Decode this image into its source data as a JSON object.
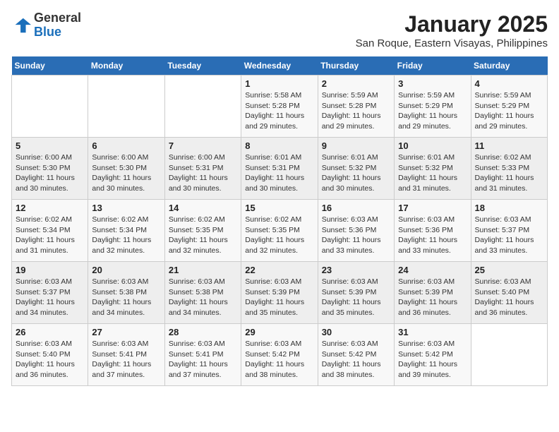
{
  "header": {
    "logo_general": "General",
    "logo_blue": "Blue",
    "title": "January 2025",
    "subtitle": "San Roque, Eastern Visayas, Philippines"
  },
  "weekdays": [
    "Sunday",
    "Monday",
    "Tuesday",
    "Wednesday",
    "Thursday",
    "Friday",
    "Saturday"
  ],
  "weeks": [
    [
      {
        "day": "",
        "detail": ""
      },
      {
        "day": "",
        "detail": ""
      },
      {
        "day": "",
        "detail": ""
      },
      {
        "day": "1",
        "detail": "Sunrise: 5:58 AM\nSunset: 5:28 PM\nDaylight: 11 hours\nand 29 minutes."
      },
      {
        "day": "2",
        "detail": "Sunrise: 5:59 AM\nSunset: 5:28 PM\nDaylight: 11 hours\nand 29 minutes."
      },
      {
        "day": "3",
        "detail": "Sunrise: 5:59 AM\nSunset: 5:29 PM\nDaylight: 11 hours\nand 29 minutes."
      },
      {
        "day": "4",
        "detail": "Sunrise: 5:59 AM\nSunset: 5:29 PM\nDaylight: 11 hours\nand 29 minutes."
      }
    ],
    [
      {
        "day": "5",
        "detail": "Sunrise: 6:00 AM\nSunset: 5:30 PM\nDaylight: 11 hours\nand 30 minutes."
      },
      {
        "day": "6",
        "detail": "Sunrise: 6:00 AM\nSunset: 5:30 PM\nDaylight: 11 hours\nand 30 minutes."
      },
      {
        "day": "7",
        "detail": "Sunrise: 6:00 AM\nSunset: 5:31 PM\nDaylight: 11 hours\nand 30 minutes."
      },
      {
        "day": "8",
        "detail": "Sunrise: 6:01 AM\nSunset: 5:31 PM\nDaylight: 11 hours\nand 30 minutes."
      },
      {
        "day": "9",
        "detail": "Sunrise: 6:01 AM\nSunset: 5:32 PM\nDaylight: 11 hours\nand 30 minutes."
      },
      {
        "day": "10",
        "detail": "Sunrise: 6:01 AM\nSunset: 5:32 PM\nDaylight: 11 hours\nand 31 minutes."
      },
      {
        "day": "11",
        "detail": "Sunrise: 6:02 AM\nSunset: 5:33 PM\nDaylight: 11 hours\nand 31 minutes."
      }
    ],
    [
      {
        "day": "12",
        "detail": "Sunrise: 6:02 AM\nSunset: 5:34 PM\nDaylight: 11 hours\nand 31 minutes."
      },
      {
        "day": "13",
        "detail": "Sunrise: 6:02 AM\nSunset: 5:34 PM\nDaylight: 11 hours\nand 32 minutes."
      },
      {
        "day": "14",
        "detail": "Sunrise: 6:02 AM\nSunset: 5:35 PM\nDaylight: 11 hours\nand 32 minutes."
      },
      {
        "day": "15",
        "detail": "Sunrise: 6:02 AM\nSunset: 5:35 PM\nDaylight: 11 hours\nand 32 minutes."
      },
      {
        "day": "16",
        "detail": "Sunrise: 6:03 AM\nSunset: 5:36 PM\nDaylight: 11 hours\nand 33 minutes."
      },
      {
        "day": "17",
        "detail": "Sunrise: 6:03 AM\nSunset: 5:36 PM\nDaylight: 11 hours\nand 33 minutes."
      },
      {
        "day": "18",
        "detail": "Sunrise: 6:03 AM\nSunset: 5:37 PM\nDaylight: 11 hours\nand 33 minutes."
      }
    ],
    [
      {
        "day": "19",
        "detail": "Sunrise: 6:03 AM\nSunset: 5:37 PM\nDaylight: 11 hours\nand 34 minutes."
      },
      {
        "day": "20",
        "detail": "Sunrise: 6:03 AM\nSunset: 5:38 PM\nDaylight: 11 hours\nand 34 minutes."
      },
      {
        "day": "21",
        "detail": "Sunrise: 6:03 AM\nSunset: 5:38 PM\nDaylight: 11 hours\nand 34 minutes."
      },
      {
        "day": "22",
        "detail": "Sunrise: 6:03 AM\nSunset: 5:39 PM\nDaylight: 11 hours\nand 35 minutes."
      },
      {
        "day": "23",
        "detail": "Sunrise: 6:03 AM\nSunset: 5:39 PM\nDaylight: 11 hours\nand 35 minutes."
      },
      {
        "day": "24",
        "detail": "Sunrise: 6:03 AM\nSunset: 5:39 PM\nDaylight: 11 hours\nand 36 minutes."
      },
      {
        "day": "25",
        "detail": "Sunrise: 6:03 AM\nSunset: 5:40 PM\nDaylight: 11 hours\nand 36 minutes."
      }
    ],
    [
      {
        "day": "26",
        "detail": "Sunrise: 6:03 AM\nSunset: 5:40 PM\nDaylight: 11 hours\nand 36 minutes."
      },
      {
        "day": "27",
        "detail": "Sunrise: 6:03 AM\nSunset: 5:41 PM\nDaylight: 11 hours\nand 37 minutes."
      },
      {
        "day": "28",
        "detail": "Sunrise: 6:03 AM\nSunset: 5:41 PM\nDaylight: 11 hours\nand 37 minutes."
      },
      {
        "day": "29",
        "detail": "Sunrise: 6:03 AM\nSunset: 5:42 PM\nDaylight: 11 hours\nand 38 minutes."
      },
      {
        "day": "30",
        "detail": "Sunrise: 6:03 AM\nSunset: 5:42 PM\nDaylight: 11 hours\nand 38 minutes."
      },
      {
        "day": "31",
        "detail": "Sunrise: 6:03 AM\nSunset: 5:42 PM\nDaylight: 11 hours\nand 39 minutes."
      },
      {
        "day": "",
        "detail": ""
      }
    ]
  ]
}
